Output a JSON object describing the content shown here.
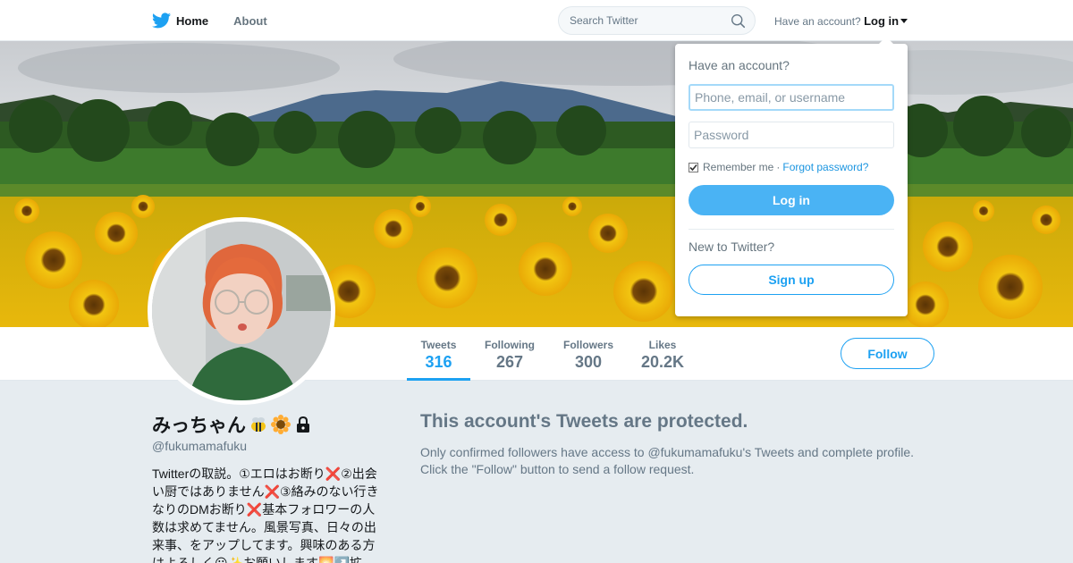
{
  "nav": {
    "home_label": "Home",
    "about_label": "About",
    "search_placeholder": "Search Twitter",
    "have_account": "Have an account?",
    "login_label": "Log in"
  },
  "profile": {
    "name": "みっちゃん",
    "handle": "@fukumamafuku",
    "bio": "Twitterの取説。①エロはお断り❌②出会い厨ではありません❌③絡みのない行きなりのDMお断り❌基本フォロワーの人数は求めてません。風景写真、日々の出来事、をアップしてます。興味のある方はよろしく😃✨お願いします🌅↗️拡",
    "stats": [
      {
        "label": "Tweets",
        "value": "316"
      },
      {
        "label": "Following",
        "value": "267"
      },
      {
        "label": "Followers",
        "value": "300"
      },
      {
        "label": "Likes",
        "value": "20.2K"
      }
    ],
    "follow_label": "Follow"
  },
  "protected": {
    "title": "This account's Tweets are protected.",
    "text": "Only confirmed followers have access to @fukumamafuku's Tweets and complete profile. Click the \"Follow\" button to send a follow request."
  },
  "login_dropdown": {
    "heading": "Have an account?",
    "username_placeholder": "Phone, email, or username",
    "password_placeholder": "Password",
    "remember_label": "Remember me",
    "separator": "·",
    "forgot_label": "Forgot password?",
    "login_button": "Log in",
    "new_to_twitter": "New to Twitter?",
    "signup_button": "Sign up"
  },
  "icons": {
    "logo": "twitter-bird-icon",
    "search": "search-icon",
    "lock": "lock-icon",
    "bee": "bee-emoji-icon",
    "sunflower": "sunflower-emoji-icon"
  },
  "colors": {
    "brand": "#1da1f2",
    "login_button": "#4ab3f4",
    "page_background": "#e6ecf0",
    "muted_text": "#657786"
  }
}
